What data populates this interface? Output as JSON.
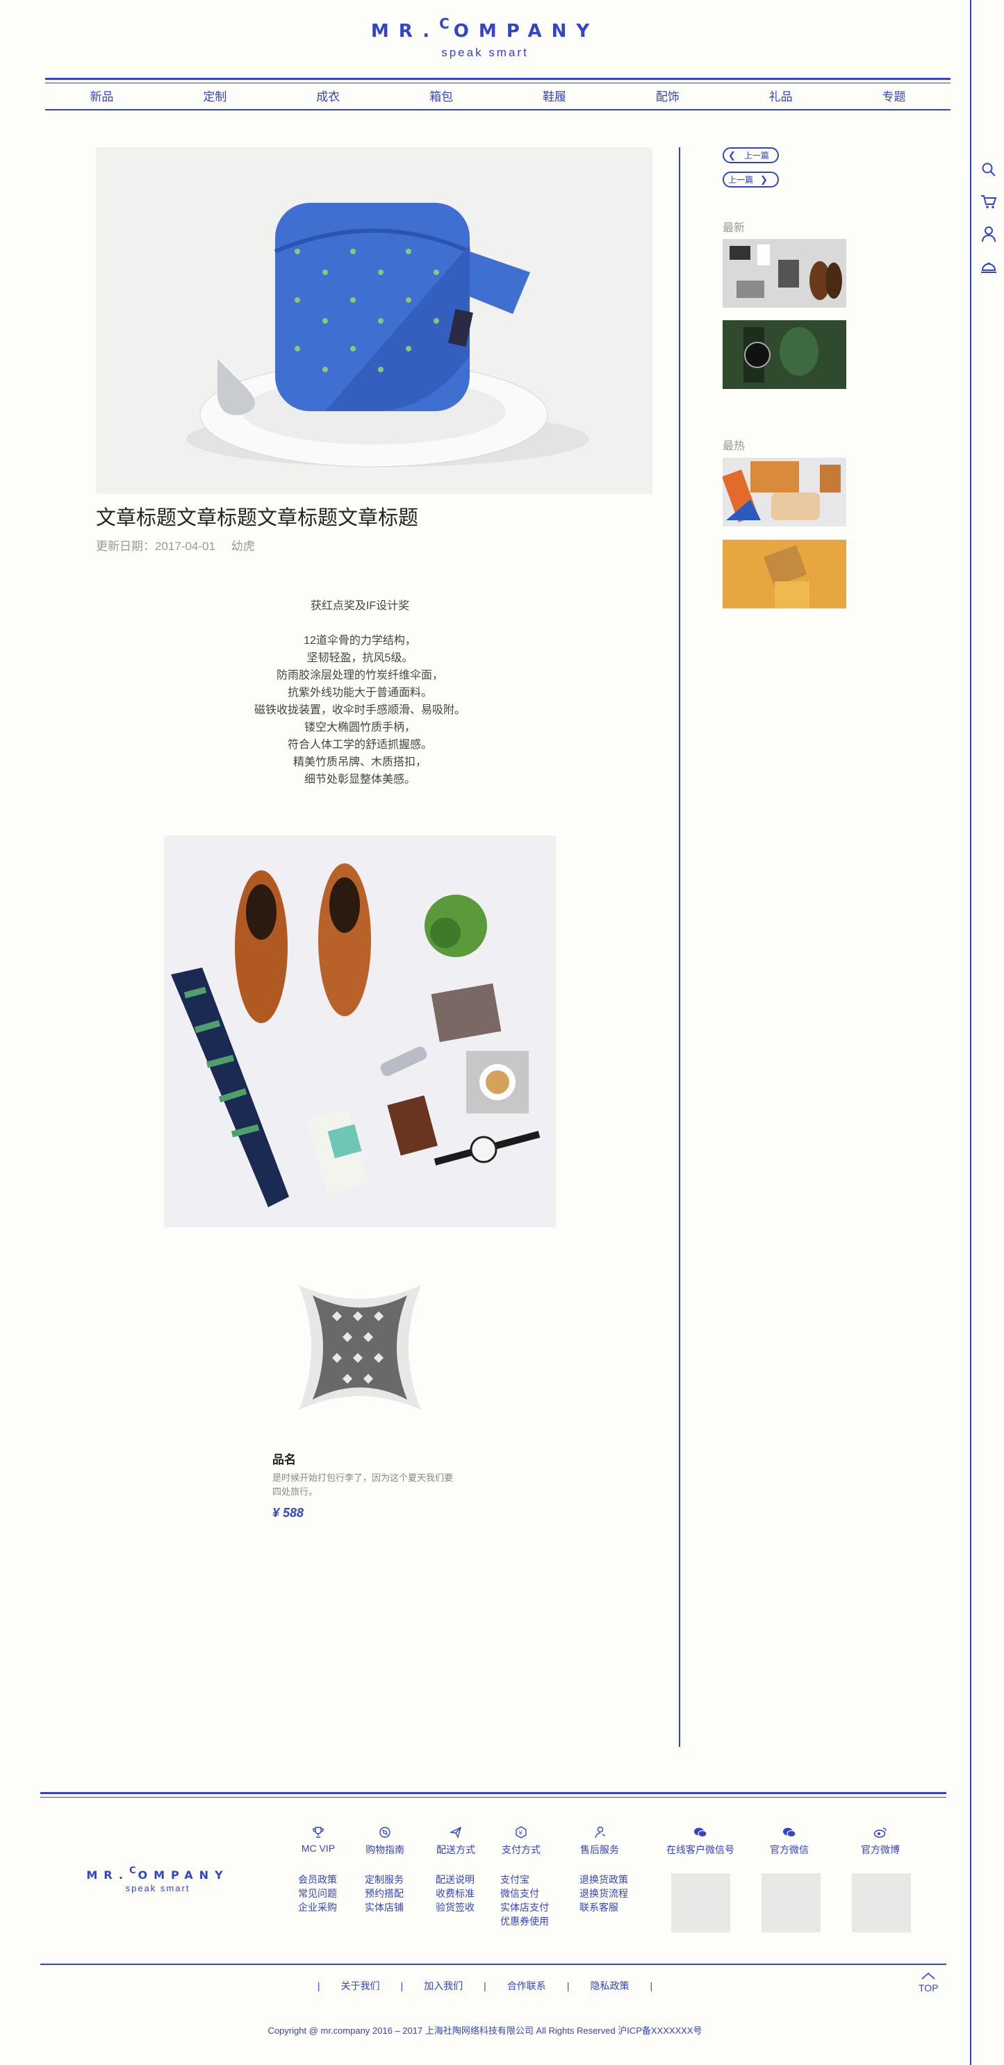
{
  "brand": {
    "logo_left": "MR.",
    "logo_c": "C",
    "logo_right": "OMPANY",
    "tagline": "speak smart"
  },
  "colors": {
    "accent": "#3344c9",
    "background": "#fdfdf9"
  },
  "nav": [
    "新品",
    "定制",
    "成衣",
    "箱包",
    "鞋履",
    "配饰",
    "礼品",
    "专题"
  ],
  "rail_icons": [
    "search-icon",
    "cart-icon",
    "user-icon",
    "service-bell-icon"
  ],
  "article": {
    "title": "文章标题文章标题文章标题文章标题",
    "date": "更新日期：2017-04-01",
    "author": "幼虎",
    "lead": "获红点奖及IF设计奖",
    "lines": [
      "12道伞骨的力学结构，",
      "坚韧轻盈，抗风5级。",
      "防雨胶涂层处理的竹炭纤维伞面，",
      "抗紫外线功能大于普通面料。",
      "磁铁收拢装置，收伞时手感顺滑、易吸附。",
      "镂空大椭圆竹质手柄，",
      "符合人体工学的舒适抓握感。",
      "精美竹质吊牌、木质搭扣，",
      "细节处彰显整体美感。"
    ]
  },
  "product": {
    "name": "品名",
    "desc": "是时候开始打包行李了，因为这个夏天我们要四处旅行。",
    "price": "¥ 588"
  },
  "sidebar": {
    "prev_label": "上一篇",
    "next_label": "上一篇",
    "latest": "最新",
    "hot": "最热"
  },
  "footer": {
    "logo_left": "MR.",
    "logo_c": "C",
    "logo_right": "OMPANY",
    "tagline": "speak smart",
    "columns": [
      {
        "icon": "trophy-icon",
        "title": "MC VIP",
        "links": [
          "会员政策",
          "常见问题",
          "企业采购"
        ]
      },
      {
        "icon": "compass-icon",
        "title": "购物指南",
        "links": [
          "定制服务",
          "预约搭配",
          "实体店铺"
        ]
      },
      {
        "icon": "paper-plane-icon",
        "title": "配送方式",
        "links": [
          "配送说明",
          "收费标准",
          "验货签收"
        ]
      },
      {
        "icon": "payment-hex-icon",
        "title": "支付方式",
        "links": [
          "支付宝",
          "微信支付",
          "实体店支付",
          "优惠券使用"
        ]
      },
      {
        "icon": "service-person-icon",
        "title": "售后服务",
        "links": [
          "退换货政策",
          "退换货流程",
          "联系客服"
        ]
      }
    ],
    "social": [
      {
        "icon": "wechat-icon",
        "title": "在线客户微信号"
      },
      {
        "icon": "wechat-icon",
        "title": "官方微信"
      },
      {
        "icon": "weibo-icon",
        "title": "官方微博"
      }
    ],
    "bottom_links": [
      "关于我们",
      "加入我们",
      "合作联系",
      "隐私政策"
    ],
    "top_label": "TOP",
    "copyright": "Copyright @ mr.company 2016 – 2017 上海社陶网络科技有限公司  All Rights Reserved    沪ICP备XXXXXXX号"
  }
}
